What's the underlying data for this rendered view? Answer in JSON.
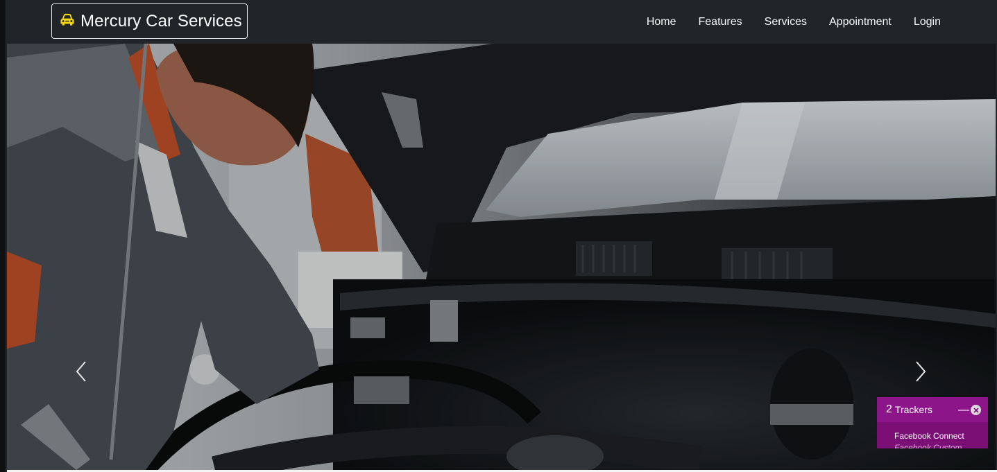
{
  "brand": {
    "name": "Mercury Car Services",
    "icon": "car-icon",
    "icon_color": "#f3d80f"
  },
  "nav": {
    "items": [
      {
        "label": "Home"
      },
      {
        "label": "Features"
      },
      {
        "label": "Services"
      },
      {
        "label": "Appointment"
      },
      {
        "label": "Login"
      }
    ]
  },
  "carousel": {
    "image_alt": "Mechanic working under the hood of a car",
    "prev_icon": "chevron-left-icon",
    "next_icon": "chevron-right-icon"
  },
  "tracker_widget": {
    "count": "2",
    "label": "Trackers",
    "minimize_icon": "minus-icon",
    "close_icon": "close-icon",
    "items": [
      "Facebook Connect",
      "Facebook Custom"
    ],
    "color": "#7b0f76"
  },
  "colors": {
    "navbar": "#212529",
    "nav_text": "#f8f9fa"
  }
}
